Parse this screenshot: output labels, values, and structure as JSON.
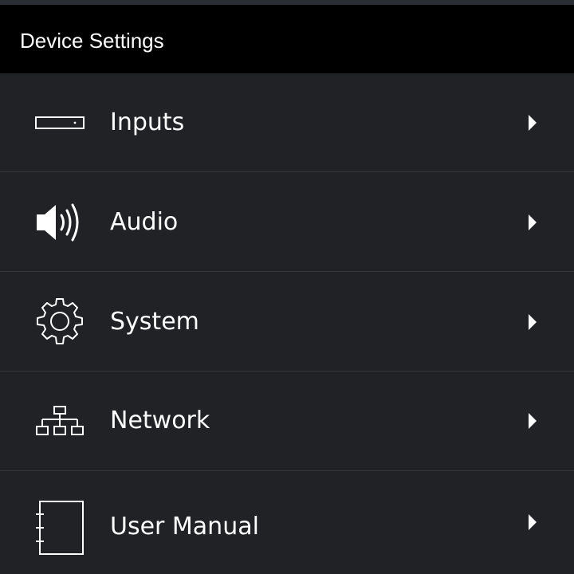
{
  "header": {
    "title": "Device Settings"
  },
  "menu": {
    "items": [
      {
        "label": "Inputs",
        "icon": "input-device-icon"
      },
      {
        "label": "Audio",
        "icon": "speaker-icon"
      },
      {
        "label": "System",
        "icon": "gear-icon"
      },
      {
        "label": "Network",
        "icon": "network-icon"
      },
      {
        "label": "User Manual",
        "icon": "notebook-icon"
      }
    ]
  },
  "colors": {
    "background": "#202225",
    "header": "#000000",
    "divider": "#33363b",
    "text": "#ffffff"
  }
}
